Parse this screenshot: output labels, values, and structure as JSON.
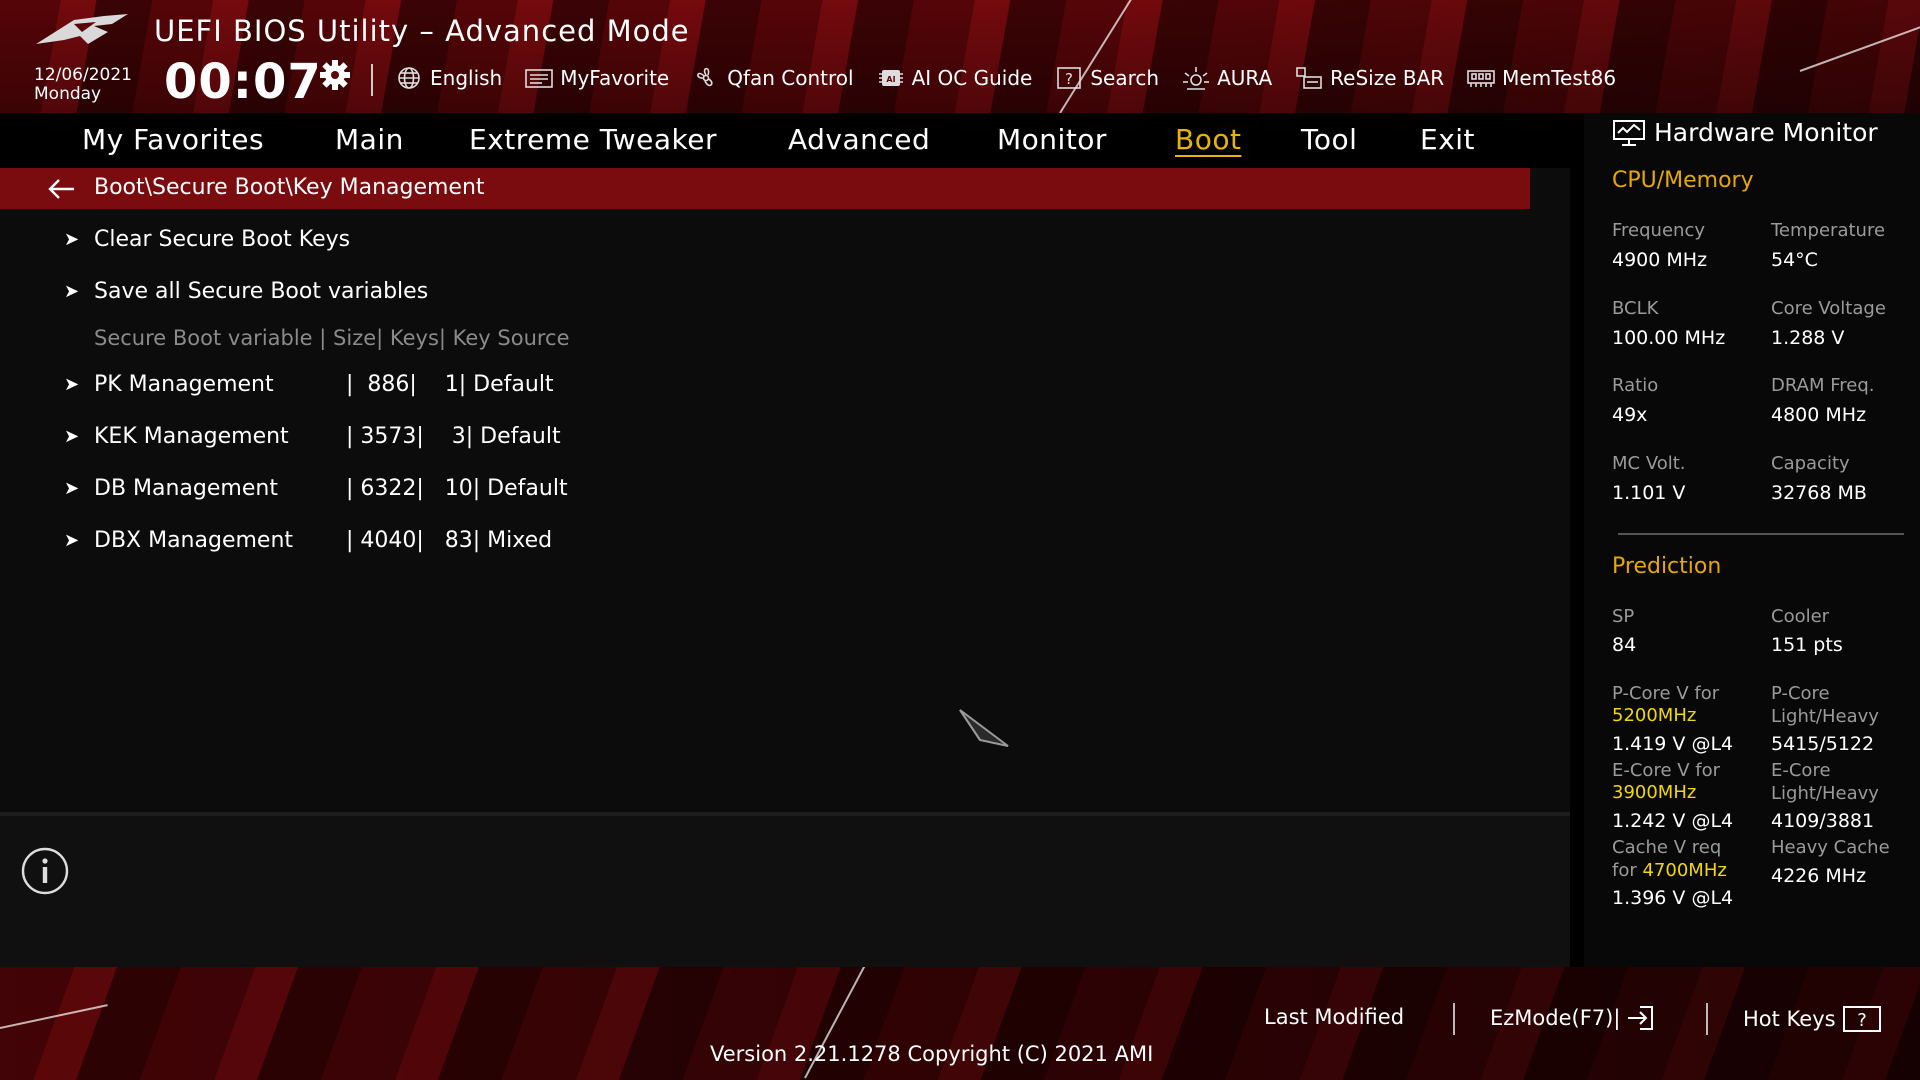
{
  "header": {
    "title": "UEFI BIOS Utility – Advanced Mode",
    "date": "12/06/2021",
    "day": "Monday",
    "time": "00:07",
    "toolbar": [
      {
        "label": "English",
        "icon": "globe-icon"
      },
      {
        "label": "MyFavorite",
        "icon": "favorite-icon"
      },
      {
        "label": "Qfan Control",
        "icon": "fan-icon"
      },
      {
        "label": "AI OC Guide",
        "icon": "ai-chip-icon"
      },
      {
        "label": "Search",
        "icon": "question-box-icon"
      },
      {
        "label": "AURA",
        "icon": "aura-icon"
      },
      {
        "label": "ReSize BAR",
        "icon": "resize-bar-icon"
      },
      {
        "label": "MemTest86",
        "icon": "memory-icon"
      }
    ]
  },
  "menu": {
    "items": [
      "My Favorites",
      "Main",
      "Extreme Tweaker",
      "Advanced",
      "Monitor",
      "Boot",
      "Tool",
      "Exit"
    ],
    "active": "Boot"
  },
  "content": {
    "breadcrumb": "Boot\\Secure Boot\\Key Management",
    "actions": [
      "Clear Secure Boot Keys",
      "Save all Secure Boot variables"
    ],
    "table_header": "Secure Boot variable  | Size| Keys| Key Source",
    "rows": [
      {
        "label": "PK Management",
        "data": "|  886|    1| Default"
      },
      {
        "label": "KEK Management",
        "data": "| 3573|    3| Default"
      },
      {
        "label": "DB Management",
        "data": "| 6322|   10| Default"
      },
      {
        "label": "DBX Management",
        "data": "| 4040|   83| Mixed"
      }
    ]
  },
  "hardware_monitor": {
    "title": "Hardware Monitor",
    "cpu_memory": {
      "heading": "CPU/Memory",
      "frequency_label": "Frequency",
      "frequency": "4900 MHz",
      "temperature_label": "Temperature",
      "temperature": "54°C",
      "bclk_label": "BCLK",
      "bclk": "100.00 MHz",
      "core_voltage_label": "Core Voltage",
      "core_voltage": "1.288 V",
      "ratio_label": "Ratio",
      "ratio": "49x",
      "dram_freq_label": "DRAM Freq.",
      "dram_freq": "4800 MHz",
      "mc_volt_label": "MC Volt.",
      "mc_volt": "1.101 V",
      "capacity_label": "Capacity",
      "capacity": "32768 MB"
    },
    "prediction": {
      "heading": "Prediction",
      "sp_label": "SP",
      "sp": "84",
      "cooler_label": "Cooler",
      "cooler": "151 pts",
      "pcore_v_label": "P-Core V for",
      "pcore_v_freq": "5200MHz",
      "pcore_v": "1.419 V @L4",
      "pcore_lh_label_1": "P-Core",
      "pcore_lh_label_2": "Light/Heavy",
      "pcore_lh": "5415/5122",
      "ecore_v_label": "E-Core V for",
      "ecore_v_freq": "3900MHz",
      "ecore_v": "1.242 V @L4",
      "ecore_lh_label_1": "E-Core",
      "ecore_lh_label_2": "Light/Heavy",
      "ecore_lh": "4109/3881",
      "cache_v_label_1": "Cache V req",
      "cache_v_label_2": "for",
      "cache_v_freq": "4700MHz",
      "cache_v": "1.396 V @L4",
      "heavy_cache_label": "Heavy Cache",
      "heavy_cache": "4226 MHz"
    }
  },
  "footer": {
    "last_modified": "Last Modified",
    "ezmode": "EzMode(F7)|",
    "hot_keys": "Hot Keys",
    "version": "Version 2.21.1278 Copyright (C) 2021 AMI"
  },
  "colors": {
    "accent": "#e8b400",
    "highlight": "#f2d800",
    "breadcrumb_bg": "#7a0c10"
  }
}
